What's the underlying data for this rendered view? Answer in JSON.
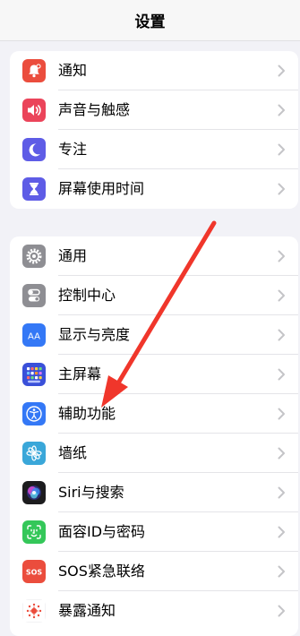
{
  "nav": {
    "title": "设置"
  },
  "group1": [
    {
      "label": "通知",
      "icon": "notifications-icon",
      "color": "#eb4d3d"
    },
    {
      "label": "声音与触感",
      "icon": "sounds-icon",
      "color": "#eb445a"
    },
    {
      "label": "专注",
      "icon": "focus-moon-icon",
      "color": "#5e5ce6"
    },
    {
      "label": "屏幕使用时间",
      "icon": "screen-time-hourglass-icon",
      "color": "#5e5ce6"
    }
  ],
  "group2": [
    {
      "label": "通用",
      "icon": "general-gear-icon",
      "color": "#8e8e93"
    },
    {
      "label": "控制中心",
      "icon": "control-center-icon",
      "color": "#8e8e93"
    },
    {
      "label": "显示与亮度",
      "icon": "display-brightness-icon",
      "color": "#3478f6"
    },
    {
      "label": "主屏幕",
      "icon": "home-screen-icon",
      "color": "#3a50d9"
    },
    {
      "label": "辅助功能",
      "icon": "accessibility-icon",
      "color": "#3478f6"
    },
    {
      "label": "墙纸",
      "icon": "wallpaper-icon",
      "color": "#3aa7d9"
    },
    {
      "label": "Siri与搜索",
      "icon": "siri-icon",
      "color": "#1c1c1e"
    },
    {
      "label": "面容ID与密码",
      "icon": "face-id-icon",
      "color": "#34c759"
    },
    {
      "label": "SOS紧急联络",
      "icon": "sos-icon",
      "color": "#eb4d3d"
    },
    {
      "label": "暴露通知",
      "icon": "exposure-notification-icon",
      "color": "#ffffff"
    }
  ],
  "icon_text": {
    "display": "AA",
    "sos": "SOS"
  },
  "annotation": {
    "color": "#f0362b"
  }
}
